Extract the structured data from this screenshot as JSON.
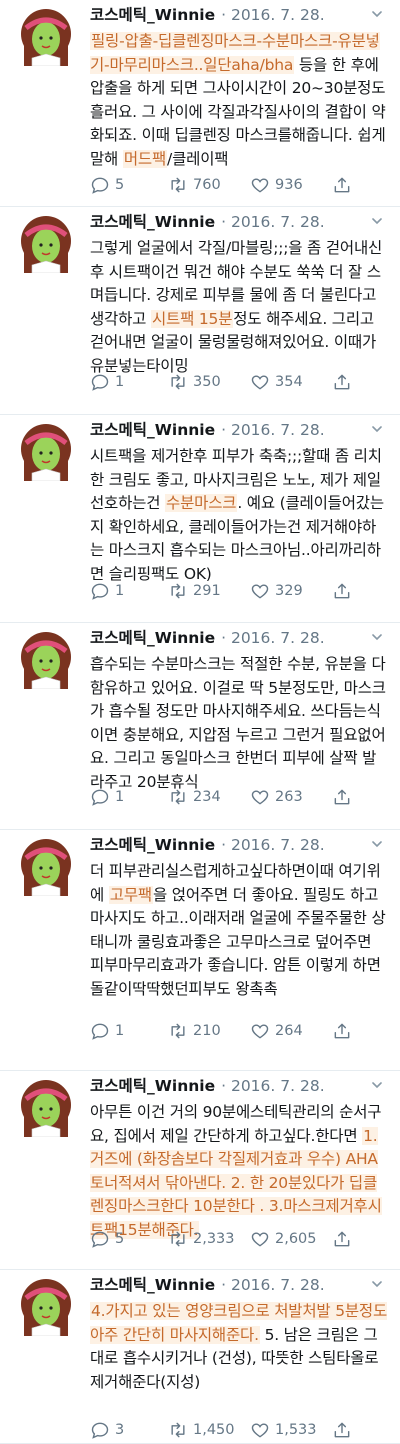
{
  "author": "코스메틱_Winnie",
  "date": "2016. 7. 28.",
  "colors": {
    "highlight_bg": "#fdf1e4",
    "highlight_text": "#c56a2c",
    "meta": "#657786",
    "avatar_face": "#9bd35a",
    "avatar_hair": "#7a3320",
    "avatar_band": "#e0507a"
  },
  "icons": {
    "reply": "reply-icon",
    "retweet": "retweet-icon",
    "like": "heart-icon",
    "share": "share-icon",
    "menu": "chevron-down-icon"
  },
  "tweets": [
    {
      "segments": [
        {
          "t": "필링-압출-딥클렌징마스크-수분마스크-유분넣기-마무리마스크..일단aha/bha",
          "h": true
        },
        {
          "t": " 등을 한 후에 압출을 하게 되면 그사이시간이 20~30분정도 흘러요. 그 사이에 각질과각질사이의 결합이 약화되죠. 이때 딥클렌징 마스크를해줍니다. 쉽게 말해 ",
          "h": false
        },
        {
          "t": "머드팩",
          "h": true
        },
        {
          "t": "/클레이팩",
          "h": false
        }
      ],
      "replies": "5",
      "retweets": "760",
      "likes": "936"
    },
    {
      "segments": [
        {
          "t": "그렇게 얼굴에서 각질/마블링;;;을 좀 걷어내신 후 시트팩이건 뭐건 해야 수분도 쑥쑥 더 잘 스며듭니다. 강제로 피부를 물에 좀 더 불린다고 생각하고 ",
          "h": false
        },
        {
          "t": "시트팩 15분",
          "h": true
        },
        {
          "t": "정도 해주세요.  그리고 걷어내면 얼굴이 물렁물렁해져있어요. 이때가 유분넣는타이밍",
          "h": false
        }
      ],
      "replies": "1",
      "retweets": "350",
      "likes": "354"
    },
    {
      "segments": [
        {
          "t": "시트팩을 제거한후 피부가 축축;;;할때 좀 리치한 크림도 좋고, 마사지크림은 노노, 제가 제일선호하는건 ",
          "h": false
        },
        {
          "t": "수분마스크",
          "h": true
        },
        {
          "t": ". 예요 (클레이들어갔는지 확인하세요, 클레이들어가는건 제거해야하는 마스크지 흡수되는 마스크아님..아리까리하면 슬리핑팩도 OK)",
          "h": false
        }
      ],
      "replies": "1",
      "retweets": "291",
      "likes": "329"
    },
    {
      "segments": [
        {
          "t": "흡수되는 수분마스크는 적절한 수분, 유분을 다 함유하고 있어요. 이걸로 딱 5분정도만, 마스크가 흡수될 정도만 마사지해주세요.  쓰다듬는식이면 충분해요, 지압점 누르고 그런거 필요없어요. 그리고 동일마스크 한번더 피부에 살짝 발라주고 20분휴식",
          "h": false
        }
      ],
      "replies": "1",
      "retweets": "234",
      "likes": "263"
    },
    {
      "segments": [
        {
          "t": "더 피부관리실스럽게하고싶다하면이때 여기위에 ",
          "h": false
        },
        {
          "t": "고무팩",
          "h": true
        },
        {
          "t": "을 얹어주면 더 좋아요. 필링도 하고 마사지도 하고..이래저래 얼굴에 주물주물한 상태니까 쿨링효과좋은 고무마스크로 덮어주면 피부마무리효과가 좋습니다. 암튼 이렇게 하면 돌같이딱딱했던피부도 왕촉촉",
          "h": false
        }
      ],
      "replies": "1",
      "retweets": "210",
      "likes": "264"
    },
    {
      "segments": [
        {
          "t": "아무튼 이건 거의 90분에스테틱관리의 순서구요, 집에서 제일 간단하게 하고싶다.한다면 ",
          "h": false
        },
        {
          "t": "1.거즈에 (화장솜보다 각질제거효과 우수)  AHA 토너적셔서 닦아낸다.  2. 한 20분있다가 딥클렌징마스크한다 10분한다 . 3.마스크제거후시트팩15분해준다.",
          "h": true
        }
      ],
      "replies": "5",
      "retweets": "2,333",
      "likes": "2,605"
    },
    {
      "segments": [
        {
          "t": "4.가지고 있는 영양크림으로 처발처발 5분정도 아주 간단히 마사지해준다.",
          "h": true
        },
        {
          "t": "  5. 남은 크림은 그대로 흡수시키거나 (건성), 따뜻한 스팀타올로 제거해준다(지성)",
          "h": false
        }
      ],
      "replies": "3",
      "retweets": "1,450",
      "likes": "1,533"
    }
  ]
}
